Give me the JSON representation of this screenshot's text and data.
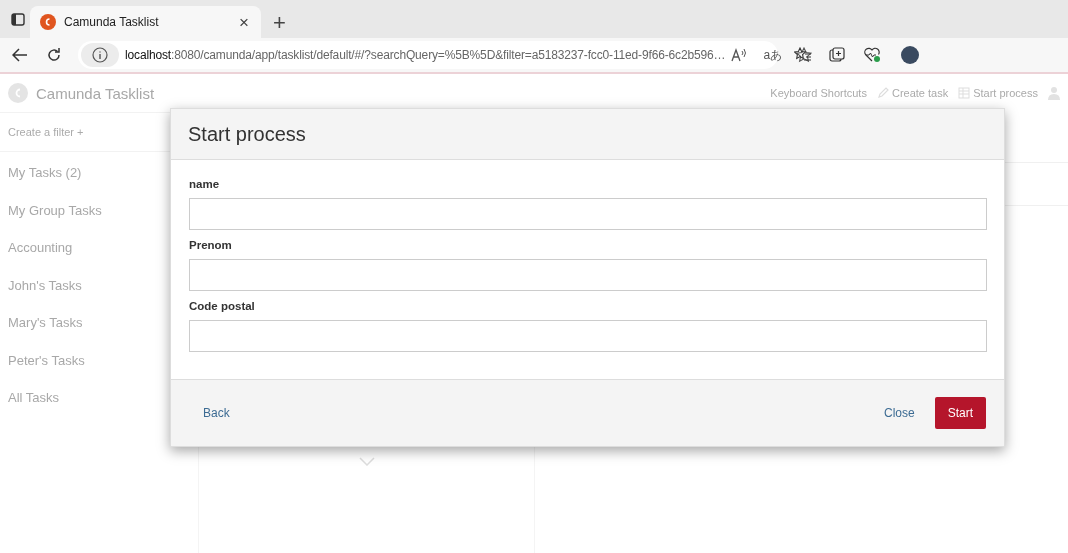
{
  "browser": {
    "tab": {
      "title": "Camunda Tasklist",
      "close": "×"
    },
    "new_tab": "+",
    "url": "**localhost**:8080/camunda/app/tasklist/default/#/?searchQuery=%5B%5D&filter=a5183237-fcc0-11ed-9f66-6c2b596…",
    "translate": "aあ"
  },
  "app": {
    "title": "Camunda Tasklist",
    "nav": [
      {
        "label": "Keyboard Shortcuts",
        "kind": "plain"
      },
      {
        "label": "Create task",
        "kind": "create"
      },
      {
        "label": "Start process",
        "kind": "start"
      }
    ],
    "create_filter": "Create a filter +",
    "filters": [
      "My Tasks (2)",
      "My Group Tasks",
      "Accounting",
      "John's Tasks",
      "Mary's Tasks",
      "Peter's Tasks",
      "All Tasks"
    ]
  },
  "modal": {
    "title": "Start process",
    "fields": [
      {
        "label": "name"
      },
      {
        "label": "Prenom"
      },
      {
        "label": "Code postal"
      }
    ],
    "buttons": [
      {
        "label": "Back",
        "kind": "link"
      },
      {
        "label": "Close",
        "kind": "link"
      },
      {
        "label": "Start",
        "kind": "primary"
      }
    ]
  }
}
